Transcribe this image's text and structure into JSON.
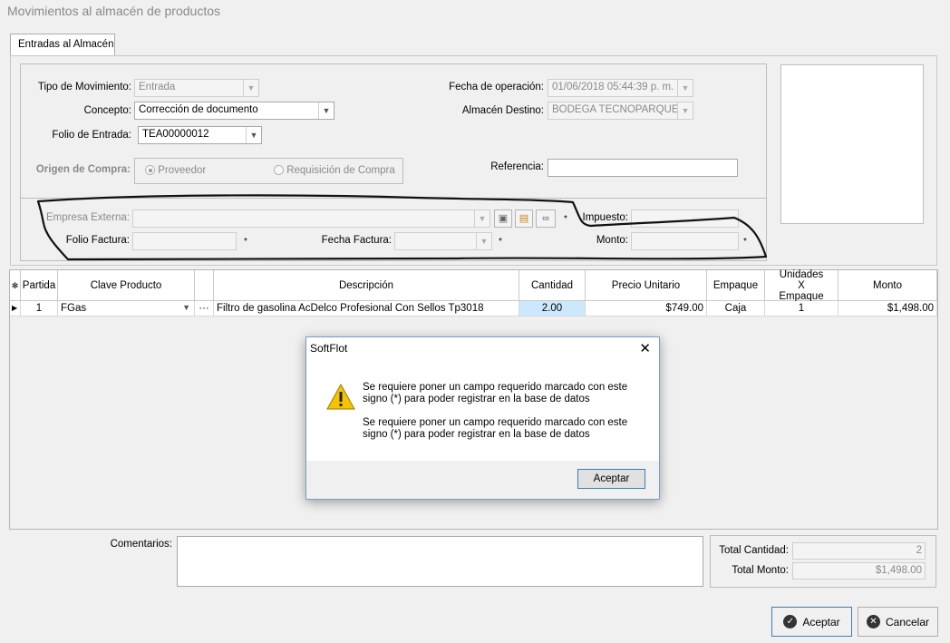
{
  "window": {
    "title": "Movimientos al almacén de productos"
  },
  "tab": {
    "label": "Entradas al Almacén"
  },
  "form": {
    "tipo_movimiento": {
      "label": "Tipo de Movimiento:",
      "value": "Entrada"
    },
    "concepto": {
      "label": "Concepto:",
      "value": "Corrección de documento"
    },
    "folio_entrada": {
      "label": "Folio de Entrada:",
      "value": "TEA00000012"
    },
    "origen_compra": {
      "label": "Origen de Compra:",
      "option1": "Proveedor",
      "option2": "Requisición de Compra"
    },
    "fecha_operacion": {
      "label": "Fecha de operación:",
      "value": "01/06/2018 05:44:39 p. m."
    },
    "almacen_destino": {
      "label": "Almacén Destino:",
      "value": "BODEGA TECNOPARQUE"
    },
    "referencia": {
      "label": "Referencia:",
      "value": ""
    },
    "empresa_externa": {
      "label": "Empresa Externa:",
      "value": ""
    },
    "folio_factura": {
      "label": "Folio Factura:",
      "value": ""
    },
    "fecha_factura": {
      "label": "Fecha Factura:",
      "value": ""
    },
    "impuesto": {
      "label": "Impuesto:",
      "value": ""
    },
    "monto": {
      "label": "Monto:",
      "value": ""
    },
    "required_marker": "*"
  },
  "grid": {
    "header_marker": "✻",
    "columns": [
      "Partida",
      "Clave Producto",
      "",
      "Descripción",
      "Cantidad",
      "Precio Unitario",
      "Empaque",
      "Unidades X Empaque",
      "Monto"
    ],
    "rows": [
      {
        "partida": "1",
        "clave": "FGas",
        "ellipsis": "···",
        "descripcion": "Filtro de gasolina AcDelco Profesional Con Sellos Tp3018",
        "cantidad": "2.00",
        "precio": "$749.00",
        "empaque": "Caja",
        "unidades": "1",
        "monto": "$1,498.00"
      }
    ]
  },
  "comentarios": {
    "label": "Comentarios:",
    "value": ""
  },
  "totals": {
    "cantidad_label": "Total Cantidad:",
    "cantidad_value": "2",
    "monto_label": "Total Monto:",
    "monto_value": "$1,498.00"
  },
  "buttons": {
    "aceptar": "Aceptar",
    "cancelar": "Cancelar"
  },
  "dialog": {
    "title": "SoftFlot",
    "message1": "Se requiere poner un campo requerido marcado con este signo (*)  para poder registrar en la base de datos",
    "message2": "Se requiere poner un campo requerido marcado con este signo (*)  para poder registrar en la base de datos",
    "ok_label": "Aceptar",
    "close_glyph": "✕"
  },
  "colors": {
    "selected_cell": "#cce8ff",
    "dialog_border": "#7a9cc6",
    "primary_button_border": "#3c7fb1"
  }
}
